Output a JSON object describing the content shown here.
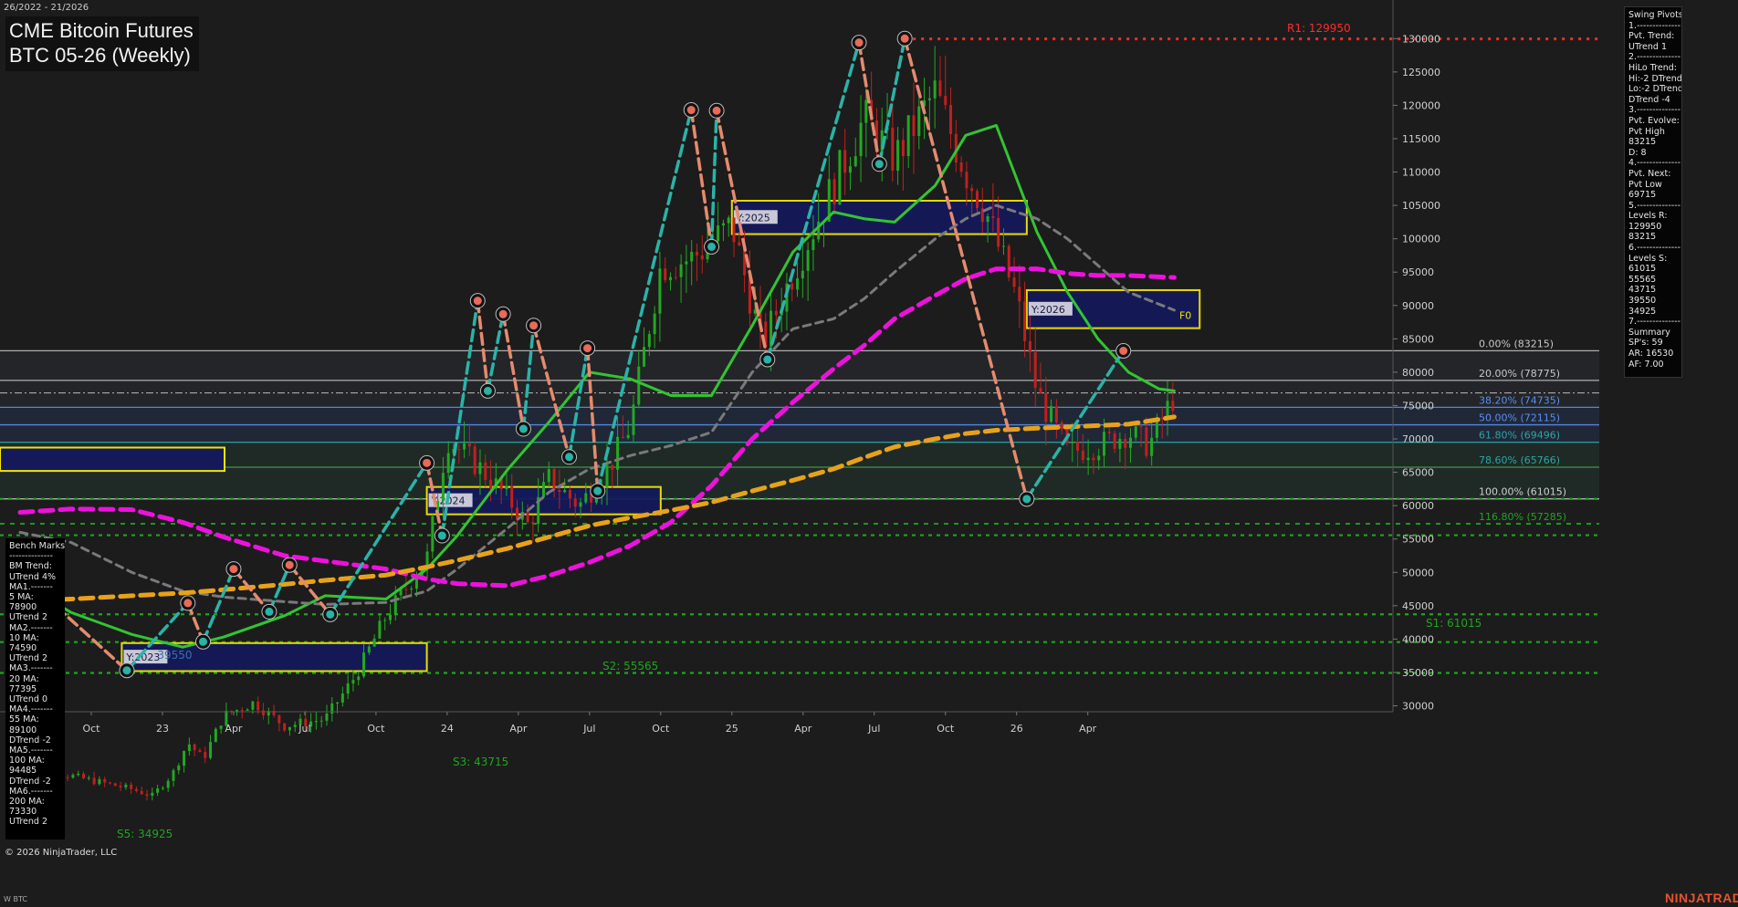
{
  "header": {
    "date_range": "26/2022 - 21/2026",
    "title_line1": "CME Bitcoin Futures",
    "title_line2": "BTC 05-26 (Weekly)"
  },
  "footer": {
    "copyright": "© 2026 NinjaTrader, LLC",
    "symbol_small": "W BTC",
    "brand": "NINJATRADER"
  },
  "swing_pivots_panel": [
    "Swing Pivots",
    "1.--------------",
    "Pvt. Trend:",
    "UTrend 1",
    "2.--------------",
    "HiLo Trend:",
    "Hi:-2 DTrend",
    "Lo:-2 DTrend",
    "DTrend -4",
    "3.--------------",
    "Pvt. Evolve:",
    "Pvt High",
    "83215",
    "D: 8",
    "4.--------------",
    "Pvt. Next:",
    "Pvt Low",
    "69715",
    "5.--------------",
    "Levels R:",
    "129950",
    "83215",
    "6.--------------",
    "Levels S:",
    "61015",
    "55565",
    "43715",
    "39550",
    "34925",
    "7.--------------",
    "Summary",
    "SP's: 59",
    "AR: 16530",
    "AF: 7.00"
  ],
  "benchmarks_panel": [
    "Bench Marks",
    "--------------",
    "BM Trend:",
    "UTrend 4%",
    "MA1.-------",
    "5 MA:",
    "78900",
    "UTrend 2",
    "MA2.-------",
    "10 MA:",
    "74590",
    "UTrend 2",
    "MA3.-------",
    "20 MA:",
    "77395",
    "UTrend 0",
    "MA4.-------",
    "55 MA:",
    "89100",
    "DTrend -2",
    "MA5.-------",
    "100 MA:",
    "94485",
    "DTrend -2",
    "MA6.-------",
    "200 MA:",
    "73330",
    "UTrend 2"
  ],
  "colors": {
    "background": "#1c1c1c",
    "candle_up": "#22a822",
    "candle_down": "#c0201f",
    "ma_green": "#33c433",
    "ma_grey": "#7a7a7a",
    "ma_magenta": "#ee11dd",
    "ma_gold": "#e8a21a",
    "swing_up": "#2bb3a8",
    "swing_down": "#e58a6e",
    "resistance": "#ff2a2a",
    "support": "#1ea51e",
    "zone_fill": "#14195a",
    "zone_border": "#f2e600"
  },
  "chart_data": {
    "type": "candlestick",
    "title": "CME Bitcoin Futures BTC 05-26 (Weekly)",
    "x_tick_labels": [
      "Jul",
      "Oct",
      "23",
      "Apr",
      "Jul",
      "Oct",
      "24",
      "Apr",
      "Jul",
      "Oct",
      "25",
      "Apr",
      "Jul",
      "Oct",
      "26",
      "Apr"
    ],
    "y_range": [
      28000,
      136000
    ],
    "y_ticks": [
      30000,
      35000,
      40000,
      45000,
      50000,
      55000,
      60000,
      65000,
      70000,
      75000,
      80000,
      85000,
      90000,
      95000,
      100000,
      105000,
      110000,
      115000,
      120000,
      125000,
      130000
    ],
    "price_path": [
      {
        "t": 0.0,
        "v": 21000
      },
      {
        "t": 0.5,
        "v": 19500
      },
      {
        "t": 1.1,
        "v": 17500
      },
      {
        "t": 1.3,
        "v": 16500
      },
      {
        "t": 1.5,
        "v": 19800
      },
      {
        "t": 1.65,
        "v": 24500
      },
      {
        "t": 1.8,
        "v": 22000
      },
      {
        "t": 2.0,
        "v": 28500
      },
      {
        "t": 2.3,
        "v": 30500
      },
      {
        "t": 2.6,
        "v": 27000
      },
      {
        "t": 3.0,
        "v": 28000
      },
      {
        "t": 3.3,
        "v": 34500
      },
      {
        "t": 3.6,
        "v": 43500
      },
      {
        "t": 4.0,
        "v": 52000
      },
      {
        "t": 4.2,
        "v": 70000
      },
      {
        "t": 4.5,
        "v": 66000
      },
      {
        "t": 4.8,
        "v": 61000
      },
      {
        "t": 5.0,
        "v": 57000
      },
      {
        "t": 5.2,
        "v": 64000
      },
      {
        "t": 5.5,
        "v": 60000
      },
      {
        "t": 5.8,
        "v": 66000
      },
      {
        "t": 6.0,
        "v": 72000
      },
      {
        "t": 6.3,
        "v": 96000
      },
      {
        "t": 6.6,
        "v": 97000
      },
      {
        "t": 7.0,
        "v": 102000
      },
      {
        "t": 7.3,
        "v": 84000
      },
      {
        "t": 7.6,
        "v": 95000
      },
      {
        "t": 8.0,
        "v": 108000
      },
      {
        "t": 8.3,
        "v": 118000
      },
      {
        "t": 8.6,
        "v": 112000
      },
      {
        "t": 9.0,
        "v": 122000
      },
      {
        "t": 9.3,
        "v": 110000
      },
      {
        "t": 9.5,
        "v": 104000
      },
      {
        "t": 9.8,
        "v": 91000
      },
      {
        "t": 10.0,
        "v": 77000
      },
      {
        "t": 10.3,
        "v": 68000
      },
      {
        "t": 10.6,
        "v": 69000
      },
      {
        "t": 10.9,
        "v": 71000
      },
      {
        "t": 11.1,
        "v": 69000
      },
      {
        "t": 11.35,
        "v": 76500
      }
    ],
    "moving_averages": [
      {
        "name": "ma-green",
        "style": "solid",
        "color": "#33c433",
        "points": [
          {
            "t": 0.0,
            "v": 48500
          },
          {
            "t": 0.5,
            "v": 44000
          },
          {
            "t": 1.1,
            "v": 40700
          },
          {
            "t": 1.6,
            "v": 38800
          },
          {
            "t": 2.0,
            "v": 40300
          },
          {
            "t": 2.6,
            "v": 43500
          },
          {
            "t": 3.0,
            "v": 46500
          },
          {
            "t": 3.6,
            "v": 46000
          },
          {
            "t": 4.0,
            "v": 50500
          },
          {
            "t": 4.3,
            "v": 55500
          },
          {
            "t": 4.8,
            "v": 65500
          },
          {
            "t": 5.2,
            "v": 72500
          },
          {
            "t": 5.6,
            "v": 80000
          },
          {
            "t": 6.0,
            "v": 79000
          },
          {
            "t": 6.4,
            "v": 76500
          },
          {
            "t": 6.8,
            "v": 76500
          },
          {
            "t": 7.2,
            "v": 87000
          },
          {
            "t": 7.6,
            "v": 98000
          },
          {
            "t": 8.0,
            "v": 104000
          },
          {
            "t": 8.3,
            "v": 103000
          },
          {
            "t": 8.6,
            "v": 102500
          },
          {
            "t": 9.0,
            "v": 108000
          },
          {
            "t": 9.3,
            "v": 115500
          },
          {
            "t": 9.6,
            "v": 117000
          },
          {
            "t": 10.0,
            "v": 101000
          },
          {
            "t": 10.3,
            "v": 92000
          },
          {
            "t": 10.6,
            "v": 85000
          },
          {
            "t": 10.9,
            "v": 80000
          },
          {
            "t": 11.2,
            "v": 77500
          },
          {
            "t": 11.35,
            "v": 77200
          }
        ]
      },
      {
        "name": "ma-grey",
        "style": "dash",
        "color": "#7a7a7a",
        "points": [
          {
            "t": 0.0,
            "v": 56000
          },
          {
            "t": 0.5,
            "v": 54500
          },
          {
            "t": 1.1,
            "v": 50000
          },
          {
            "t": 1.6,
            "v": 47200
          },
          {
            "t": 2.0,
            "v": 46300
          },
          {
            "t": 2.6,
            "v": 45600
          },
          {
            "t": 3.0,
            "v": 45200
          },
          {
            "t": 3.6,
            "v": 45500
          },
          {
            "t": 4.0,
            "v": 47200
          },
          {
            "t": 4.3,
            "v": 50500
          },
          {
            "t": 4.8,
            "v": 56700
          },
          {
            "t": 5.2,
            "v": 62000
          },
          {
            "t": 5.6,
            "v": 65500
          },
          {
            "t": 6.0,
            "v": 67500
          },
          {
            "t": 6.4,
            "v": 69000
          },
          {
            "t": 6.8,
            "v": 71000
          },
          {
            "t": 7.2,
            "v": 80000
          },
          {
            "t": 7.6,
            "v": 86500
          },
          {
            "t": 8.0,
            "v": 88000
          },
          {
            "t": 8.3,
            "v": 91000
          },
          {
            "t": 8.6,
            "v": 95000
          },
          {
            "t": 9.0,
            "v": 100000
          },
          {
            "t": 9.3,
            "v": 103000
          },
          {
            "t": 9.6,
            "v": 105000
          },
          {
            "t": 10.0,
            "v": 103000
          },
          {
            "t": 10.3,
            "v": 100000
          },
          {
            "t": 10.6,
            "v": 96000
          },
          {
            "t": 10.9,
            "v": 92000
          },
          {
            "t": 11.35,
            "v": 89300
          }
        ]
      },
      {
        "name": "ma-magenta",
        "style": "dash",
        "color": "#ee11dd",
        "points": [
          {
            "t": 0.0,
            "v": 59000
          },
          {
            "t": 0.5,
            "v": 59500
          },
          {
            "t": 1.1,
            "v": 59400
          },
          {
            "t": 1.6,
            "v": 57500
          },
          {
            "t": 2.0,
            "v": 55300
          },
          {
            "t": 2.6,
            "v": 52500
          },
          {
            "t": 3.0,
            "v": 51700
          },
          {
            "t": 3.6,
            "v": 50500
          },
          {
            "t": 4.0,
            "v": 49000
          },
          {
            "t": 4.3,
            "v": 48300
          },
          {
            "t": 4.8,
            "v": 48000
          },
          {
            "t": 5.2,
            "v": 49500
          },
          {
            "t": 5.6,
            "v": 51500
          },
          {
            "t": 6.0,
            "v": 54000
          },
          {
            "t": 6.4,
            "v": 57500
          },
          {
            "t": 6.8,
            "v": 63000
          },
          {
            "t": 7.2,
            "v": 70000
          },
          {
            "t": 7.6,
            "v": 75500
          },
          {
            "t": 8.0,
            "v": 80500
          },
          {
            "t": 8.3,
            "v": 84000
          },
          {
            "t": 8.6,
            "v": 88000
          },
          {
            "t": 9.0,
            "v": 91500
          },
          {
            "t": 9.3,
            "v": 94000
          },
          {
            "t": 9.6,
            "v": 95500
          },
          {
            "t": 10.0,
            "v": 95500
          },
          {
            "t": 10.3,
            "v": 94800
          },
          {
            "t": 10.6,
            "v": 94500
          },
          {
            "t": 10.9,
            "v": 94500
          },
          {
            "t": 11.35,
            "v": 94200
          }
        ]
      },
      {
        "name": "ma-gold",
        "style": "dash",
        "color": "#e8a21a",
        "points": [
          {
            "t": 0.0,
            "v": 45700
          },
          {
            "t": 0.5,
            "v": 46000
          },
          {
            "t": 1.1,
            "v": 46500
          },
          {
            "t": 1.6,
            "v": 46900
          },
          {
            "t": 2.0,
            "v": 47400
          },
          {
            "t": 2.6,
            "v": 48200
          },
          {
            "t": 3.0,
            "v": 48800
          },
          {
            "t": 3.6,
            "v": 49600
          },
          {
            "t": 4.0,
            "v": 50800
          },
          {
            "t": 4.3,
            "v": 51800
          },
          {
            "t": 4.8,
            "v": 53600
          },
          {
            "t": 5.2,
            "v": 55300
          },
          {
            "t": 5.6,
            "v": 57000
          },
          {
            "t": 6.0,
            "v": 58200
          },
          {
            "t": 6.4,
            "v": 59300
          },
          {
            "t": 6.8,
            "v": 60500
          },
          {
            "t": 7.2,
            "v": 62200
          },
          {
            "t": 7.6,
            "v": 63800
          },
          {
            "t": 8.0,
            "v": 65500
          },
          {
            "t": 8.3,
            "v": 67200
          },
          {
            "t": 8.6,
            "v": 68800
          },
          {
            "t": 9.0,
            "v": 70000
          },
          {
            "t": 9.3,
            "v": 70800
          },
          {
            "t": 9.6,
            "v": 71300
          },
          {
            "t": 10.0,
            "v": 71600
          },
          {
            "t": 10.3,
            "v": 71800
          },
          {
            "t": 10.6,
            "v": 72000
          },
          {
            "t": 10.9,
            "v": 72200
          },
          {
            "t": 11.35,
            "v": 73300
          }
        ]
      }
    ],
    "swing_pivots": [
      {
        "t": 0.0,
        "v": 49800,
        "type": "high"
      },
      {
        "t": 1.05,
        "v": 35300,
        "type": "low"
      },
      {
        "t": 1.65,
        "v": 45400,
        "type": "high"
      },
      {
        "t": 1.8,
        "v": 39600,
        "type": "low"
      },
      {
        "t": 2.1,
        "v": 50500,
        "type": "high"
      },
      {
        "t": 2.45,
        "v": 44100,
        "type": "low"
      },
      {
        "t": 2.65,
        "v": 51100,
        "type": "high"
      },
      {
        "t": 3.05,
        "v": 43700,
        "type": "low"
      },
      {
        "t": 4.0,
        "v": 66400,
        "type": "high"
      },
      {
        "t": 4.15,
        "v": 55500,
        "type": "low"
      },
      {
        "t": 4.5,
        "v": 90700,
        "type": "high"
      },
      {
        "t": 4.6,
        "v": 77200,
        "type": "low"
      },
      {
        "t": 4.75,
        "v": 88700,
        "type": "high"
      },
      {
        "t": 4.95,
        "v": 71500,
        "type": "low"
      },
      {
        "t": 5.05,
        "v": 87000,
        "type": "high"
      },
      {
        "t": 5.4,
        "v": 67300,
        "type": "low"
      },
      {
        "t": 5.58,
        "v": 83600,
        "type": "high"
      },
      {
        "t": 5.68,
        "v": 62200,
        "type": "low"
      },
      {
        "t": 6.6,
        "v": 119300,
        "type": "high"
      },
      {
        "t": 6.8,
        "v": 98800,
        "type": "low"
      },
      {
        "t": 6.85,
        "v": 119200,
        "type": "high"
      },
      {
        "t": 7.35,
        "v": 81900,
        "type": "low"
      },
      {
        "t": 8.25,
        "v": 129400,
        "type": "high"
      },
      {
        "t": 8.45,
        "v": 111200,
        "type": "low"
      },
      {
        "t": 8.7,
        "v": 130000,
        "type": "high"
      },
      {
        "t": 9.9,
        "v": 61000,
        "type": "low"
      },
      {
        "t": 10.85,
        "v": 83200,
        "type": "high"
      }
    ],
    "fib_levels": [
      {
        "pct": "0.00%",
        "value": 83215,
        "label": "0.00% (83215)",
        "color": "#c8c8c8",
        "line": "#bdbdbd"
      },
      {
        "pct": "20.00%",
        "value": 78775,
        "label": "20.00% (78775)",
        "color": "#c8c8c8",
        "line": "#bdbdbd"
      },
      {
        "pct": "38.20%",
        "value": 74735,
        "label": "38.20% (74735)",
        "color": "#5b8ef0",
        "line": "#5b8ef0"
      },
      {
        "pct": "50.00%",
        "value": 72115,
        "label": "50.00% (72115)",
        "color": "#5b8ef0",
        "line": "#5b8ef0"
      },
      {
        "pct": "61.80%",
        "value": 69496,
        "label": "61.80% (69496)",
        "color": "#2aa6a6",
        "line": "#2aa6a6"
      },
      {
        "pct": "78.60%",
        "value": 65766,
        "label": "78.60% (65766)",
        "color": "#2aa6a6",
        "line": "#4aa04a"
      },
      {
        "pct": "100.00%",
        "value": 61015,
        "label": "100.00% (61015)",
        "color": "#cfcfcf",
        "line": "#cfcfcf"
      },
      {
        "pct": "116.80%",
        "value": 57285,
        "label": "116.80% (57285)",
        "color": "#1ea51e",
        "line": "#1ea51e"
      }
    ],
    "resistance_levels": [
      {
        "label": "R1: 129950",
        "value": 129950
      }
    ],
    "support_levels": [
      {
        "label": "S1: 61015",
        "value": 61015
      },
      {
        "label": "S2: 55565",
        "value": 55565
      },
      {
        "label": "S3: 43715",
        "value": 43715
      },
      {
        "label": "",
        "value": 39550
      },
      {
        "label": "S5: 34925",
        "value": 34925
      }
    ],
    "yearly_zones": [
      {
        "label": "Y:2023",
        "low": 35200,
        "high": 39400,
        "t0": 1.0,
        "t1": 4.0
      },
      {
        "label": "Y:2024",
        "low": 58700,
        "high": 62800,
        "t0": 4.0,
        "t1": 6.3
      },
      {
        "label": "Y:2025",
        "low": 100700,
        "high": 105700,
        "t0": 7.0,
        "t1": 9.9
      },
      {
        "label": "Y:2026",
        "low": 86600,
        "high": 92300,
        "t0": 9.9,
        "t1": 11.6
      }
    ],
    "annotations": [
      {
        "text": "F0",
        "t": 11.4,
        "v": 88700
      },
      {
        "text": "39550",
        "t": 1.35,
        "v": 37700
      }
    ],
    "bench_zone": {
      "low": 65200,
      "high": 68700,
      "t0": -0.2,
      "t1": 0.9
    }
  }
}
